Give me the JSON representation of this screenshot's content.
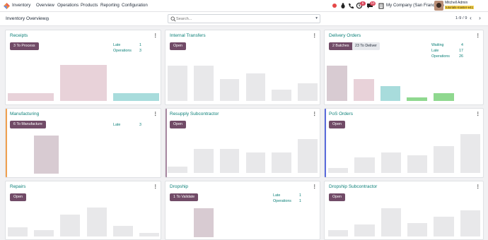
{
  "nav": {
    "brand": "Inventory",
    "menu": [
      "Overview",
      "Operations",
      "Products",
      "Reporting",
      "Configuration"
    ],
    "badges": {
      "activity": "5",
      "messages": "10"
    },
    "company": "My Company (San Francisco)",
    "user_name": "Mitchell Admin",
    "user_db": "tutorials-master-e41"
  },
  "control": {
    "breadcrumb": "Inventory Overview",
    "search_placeholder": "Search...",
    "pager": "1-9 / 9"
  },
  "colors": {
    "primary": "#714b67",
    "teal": "#0d8079",
    "bar_empty": "#e8e8ea",
    "bar_purple": "#d8cbd2",
    "bar_red": "#e8d2d9",
    "bar_cyan": "#a8dcdc",
    "bar_green": "#8fd88f"
  },
  "cards": [
    {
      "title": "Receipts",
      "primary_btn": "3 To Process",
      "stats": [
        {
          "label": "Late",
          "value": "1"
        },
        {
          "label": "Operations",
          "value": "3"
        }
      ]
    },
    {
      "title": "Internal Transfers",
      "primary_btn": "Open"
    },
    {
      "title": "Delivery Orders",
      "primary_btn": "2 Batches",
      "secondary_btn": "23 To Deliver",
      "stats": [
        {
          "label": "Waiting",
          "value": "4"
        },
        {
          "label": "Late",
          "value": "17"
        },
        {
          "label": "Operations",
          "value": "26"
        }
      ]
    },
    {
      "title": "Manufacturing",
      "primary_btn": "6 To Manufacture",
      "stats": [
        {
          "label": "Late",
          "value": "3"
        }
      ]
    },
    {
      "title": "Resupply Subcontractor",
      "primary_btn": "Open"
    },
    {
      "title": "PoS Orders",
      "primary_btn": "Open"
    },
    {
      "title": "Repairs",
      "primary_btn": "Open"
    },
    {
      "title": "Dropship",
      "primary_btn": "1 To Validate",
      "stats": [
        {
          "label": "Late",
          "value": "1"
        },
        {
          "label": "Operations",
          "value": "1"
        }
      ]
    },
    {
      "title": "Dropship Subcontractor",
      "primary_btn": "Open"
    }
  ],
  "graphs": [
    {
      "levels": [
        0.2,
        0.97,
        0.2
      ],
      "colors": [
        "red",
        "red",
        "cyan"
      ],
      "count": 3
    },
    {
      "levels": [
        0.95,
        0.95,
        0.58,
        0.73,
        0.3,
        0.48
      ],
      "colors": [
        "empty",
        "empty",
        "empty",
        "empty",
        "empty",
        "empty"
      ]
    },
    {
      "levels": [
        0.95,
        0.58,
        0.4,
        0.1,
        0.2
      ],
      "colors": [
        "purple",
        "red",
        "cyan",
        "green",
        "green"
      ]
    },
    {
      "levels": [
        0.99
      ],
      "colors": [
        "purple"
      ]
    },
    {
      "levels": [
        0.16,
        0.6,
        0.6,
        0.52,
        0.52,
        0.85
      ],
      "colors": [
        "empty",
        "empty",
        "empty",
        "empty",
        "empty",
        "empty"
      ]
    },
    {
      "levels": [
        0.12,
        0.4,
        0.52,
        0.45,
        0.68,
        0.98
      ],
      "colors": [
        "empty",
        "empty",
        "empty",
        "empty",
        "empty",
        "empty"
      ]
    },
    {
      "levels": [
        0.3,
        0.2,
        0.72,
        0.95,
        0.35,
        0.12
      ],
      "colors": [
        "empty",
        "empty",
        "empty",
        "empty",
        "empty",
        "empty"
      ]
    },
    {
      "levels": [
        0.97
      ],
      "colors": [
        "purple"
      ]
    },
    {
      "levels": [
        0.2,
        0.4,
        0.92,
        0.45,
        0.65,
        0.85
      ],
      "colors": [
        "empty",
        "empty",
        "empty",
        "empty",
        "empty",
        "empty"
      ]
    }
  ]
}
